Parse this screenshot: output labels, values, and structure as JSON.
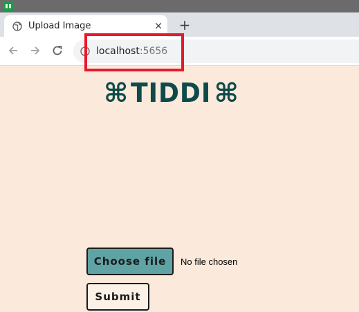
{
  "browser": {
    "tab": {
      "title": "Upload Image",
      "close_icon": "×"
    },
    "new_tab_icon": "+",
    "address": {
      "host": "localhost",
      "port": ":5656"
    }
  },
  "page": {
    "logo": {
      "left_symbol": "⌘",
      "word": "TIDDI",
      "right_symbol": "⌘"
    },
    "upload": {
      "choose_label": "Choose file",
      "status": "No file chosen",
      "submit_label": "Submit"
    }
  },
  "colors": {
    "page_background": "#fbeadb",
    "logo": "#0f4a4a",
    "choose_button": "#5fa3a5",
    "highlight": "#e8192c"
  }
}
